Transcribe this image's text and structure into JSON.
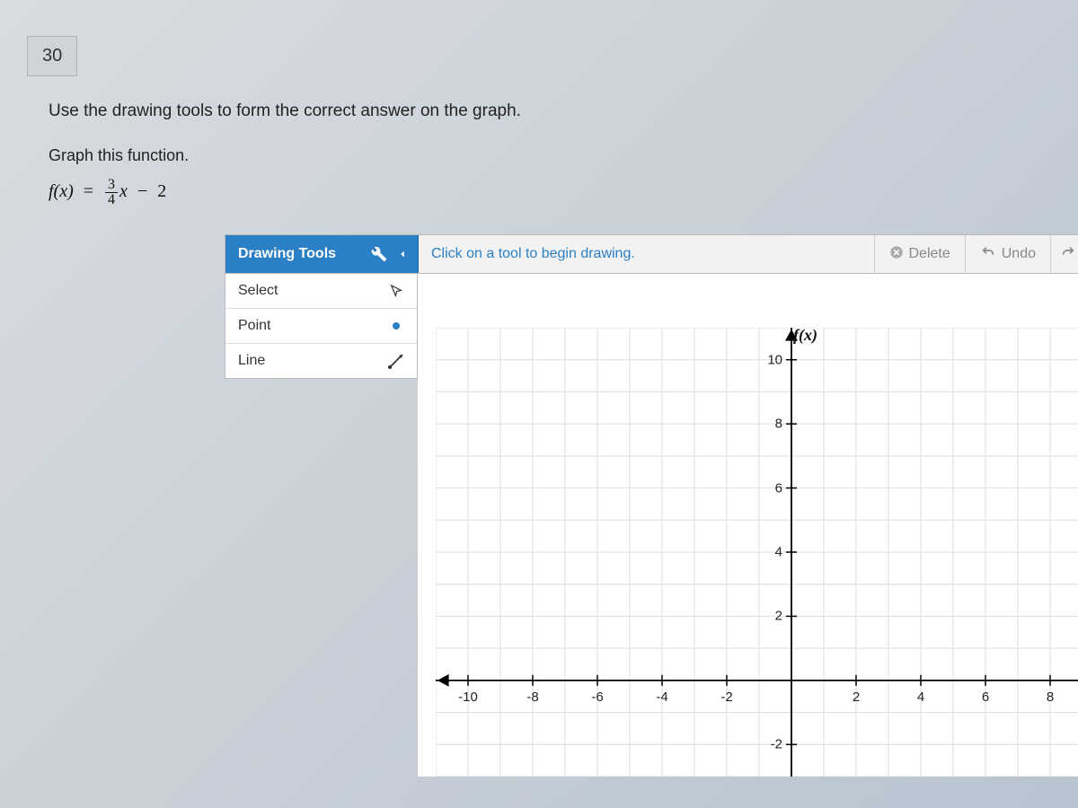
{
  "question_number": "30",
  "instruction": "Use the drawing tools to form the correct answer on the graph.",
  "sub_instruction": "Graph this function.",
  "equation": {
    "lhs": "f(x)",
    "eq": "=",
    "frac_num": "3",
    "frac_den": "4",
    "var": "x",
    "minus": "−",
    "const": "2"
  },
  "toolbar": {
    "drawing_tools": "Drawing Tools",
    "hint": "Click on a tool to begin drawing.",
    "delete": "Delete",
    "undo": "Undo"
  },
  "tools": {
    "select": "Select",
    "point": "Point",
    "line": "Line"
  },
  "chart_data": {
    "type": "line",
    "title": "",
    "xlabel": "",
    "ylabel": "f(x)",
    "x_ticks": [
      -10,
      -8,
      -6,
      -4,
      -2,
      2,
      4,
      6,
      8
    ],
    "y_ticks": [
      10,
      8,
      6,
      4,
      2,
      -2
    ],
    "xlim": [
      -11,
      9
    ],
    "ylim": [
      -3,
      11
    ],
    "series": []
  }
}
